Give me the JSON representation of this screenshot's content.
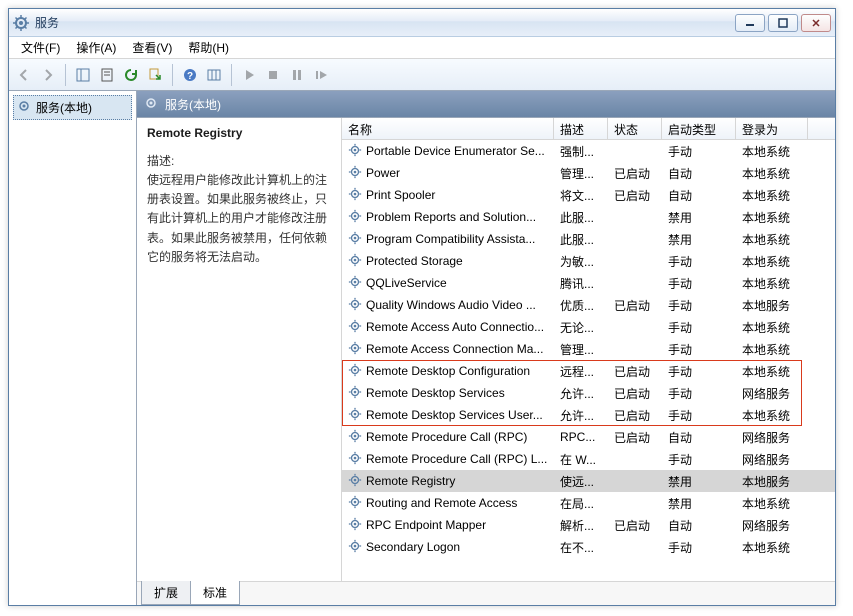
{
  "window": {
    "title": "服务"
  },
  "menu": {
    "file": "文件(F)",
    "action": "操作(A)",
    "view": "查看(V)",
    "help": "帮助(H)"
  },
  "left": {
    "node": "服务(本地)"
  },
  "rp_header": "服务(本地)",
  "detail": {
    "title": "Remote Registry",
    "label": "描述:",
    "body": "使远程用户能修改此计算机上的注册表设置。如果此服务被终止，只有此计算机上的用户才能修改注册表。如果此服务被禁用，任何依赖它的服务将无法启动。"
  },
  "columns": {
    "name": "名称",
    "desc": "描述",
    "status": "状态",
    "startup": "启动类型",
    "logon": "登录为"
  },
  "rows": [
    {
      "name": "Portable Device Enumerator Se...",
      "desc": "强制...",
      "status": "",
      "startup": "手动",
      "logon": "本地系统"
    },
    {
      "name": "Power",
      "desc": "管理...",
      "status": "已启动",
      "startup": "自动",
      "logon": "本地系统"
    },
    {
      "name": "Print Spooler",
      "desc": "将文...",
      "status": "已启动",
      "startup": "自动",
      "logon": "本地系统"
    },
    {
      "name": "Problem Reports and Solution...",
      "desc": "此服...",
      "status": "",
      "startup": "禁用",
      "logon": "本地系统"
    },
    {
      "name": "Program Compatibility Assista...",
      "desc": "此服...",
      "status": "",
      "startup": "禁用",
      "logon": "本地系统"
    },
    {
      "name": "Protected Storage",
      "desc": "为敏...",
      "status": "",
      "startup": "手动",
      "logon": "本地系统"
    },
    {
      "name": "QQLiveService",
      "desc": "腾讯...",
      "status": "",
      "startup": "手动",
      "logon": "本地系统"
    },
    {
      "name": "Quality Windows Audio Video ...",
      "desc": "优质...",
      "status": "已启动",
      "startup": "手动",
      "logon": "本地服务"
    },
    {
      "name": "Remote Access Auto Connectio...",
      "desc": "无论...",
      "status": "",
      "startup": "手动",
      "logon": "本地系统"
    },
    {
      "name": "Remote Access Connection Ma...",
      "desc": "管理...",
      "status": "",
      "startup": "手动",
      "logon": "本地系统"
    },
    {
      "name": "Remote Desktop Configuration",
      "desc": "远程...",
      "status": "已启动",
      "startup": "手动",
      "logon": "本地系统"
    },
    {
      "name": "Remote Desktop Services",
      "desc": "允许...",
      "status": "已启动",
      "startup": "手动",
      "logon": "网络服务"
    },
    {
      "name": "Remote Desktop Services User...",
      "desc": "允许...",
      "status": "已启动",
      "startup": "手动",
      "logon": "本地系统"
    },
    {
      "name": "Remote Procedure Call (RPC)",
      "desc": "RPC...",
      "status": "已启动",
      "startup": "自动",
      "logon": "网络服务"
    },
    {
      "name": "Remote Procedure Call (RPC) L...",
      "desc": "在 W...",
      "status": "",
      "startup": "手动",
      "logon": "网络服务"
    },
    {
      "name": "Remote Registry",
      "desc": "使远...",
      "status": "",
      "startup": "禁用",
      "logon": "本地服务",
      "selected": true
    },
    {
      "name": "Routing and Remote Access",
      "desc": "在局...",
      "status": "",
      "startup": "禁用",
      "logon": "本地系统"
    },
    {
      "name": "RPC Endpoint Mapper",
      "desc": "解析...",
      "status": "已启动",
      "startup": "自动",
      "logon": "网络服务"
    },
    {
      "name": "Secondary Logon",
      "desc": "在不...",
      "status": "",
      "startup": "手动",
      "logon": "本地系统"
    }
  ],
  "tabs": {
    "extended": "扩展",
    "standard": "标准"
  }
}
